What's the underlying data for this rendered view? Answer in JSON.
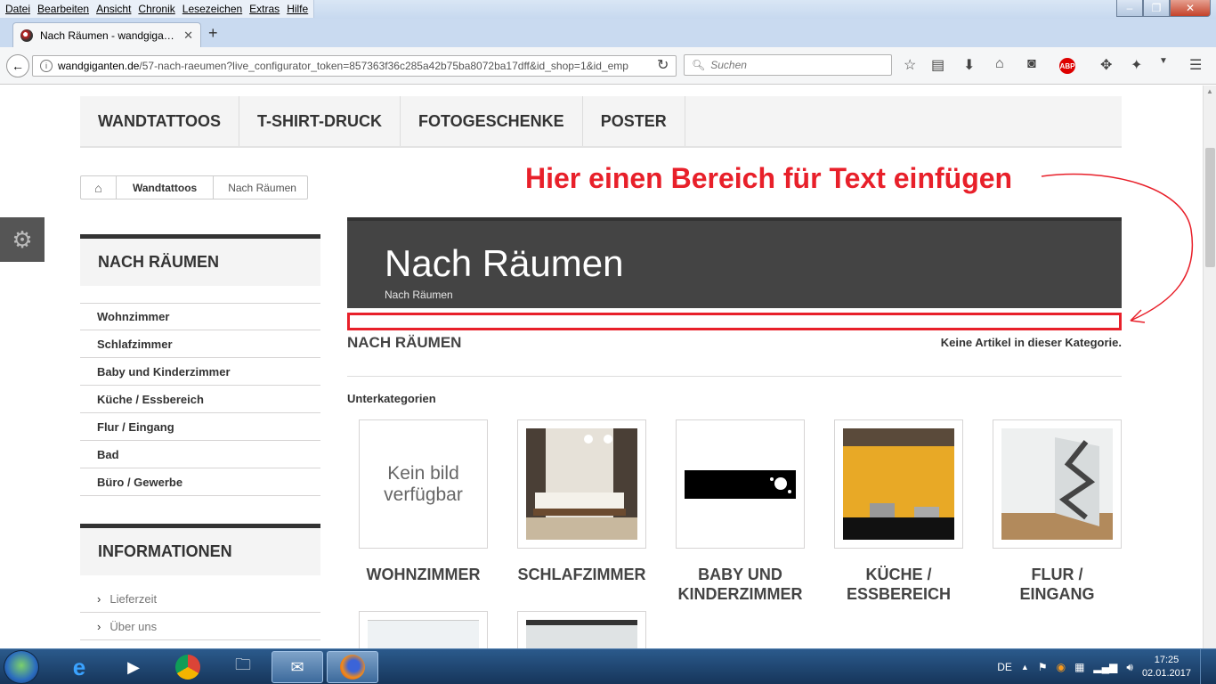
{
  "browser": {
    "menu": [
      "Datei",
      "Bearbeiten",
      "Ansicht",
      "Chronik",
      "Lesezeichen",
      "Extras",
      "Hilfe"
    ],
    "tab_title": "Nach Räumen - wandgiga…",
    "url_domain": "wandgiganten.de",
    "url_path": "/57-nach-raeumen?live_configurator_token=857363f36c285a42b75ba8072ba17dff&id_shop=1&id_emp",
    "search_placeholder": "Suchen",
    "abp_label": "ABP"
  },
  "site": {
    "nav": [
      "WANDTATTOOS",
      "T-SHIRT-DRUCK",
      "FOTOGESCHENKE",
      "POSTER"
    ],
    "breadcrumb": [
      "Wandtattoos",
      "Nach Räumen"
    ],
    "sidebar_title": "NACH RÄUMEN",
    "categories": [
      "Wohnzimmer",
      "Schlafzimmer",
      "Baby und Kinderzimmer",
      "Küche / Essbereich",
      "Flur / Eingang",
      "Bad",
      "Büro / Gewerbe"
    ],
    "info_title": "INFORMATIONEN",
    "info_links": [
      "Lieferzeit",
      "Über uns"
    ],
    "header_title": "Nach Räumen",
    "header_subtitle": "Nach Räumen",
    "section_heading": "NACH RÄUMEN",
    "empty_message": "Keine Artikel in dieser Kategorie.",
    "subcat_heading": "Unterkategorien",
    "no_image_text": "Kein bild verfügbar",
    "subcategories": [
      "WOHNZIMMER",
      "SCHLAFZIMMER",
      "BABY UND KINDERZIMMER",
      "KÜCHE / ESSBEREICH",
      "FLUR / EINGANG"
    ]
  },
  "annotation": {
    "text": "Hier einen Bereich für Text einfügen",
    "color": "#e8202a"
  },
  "taskbar": {
    "language": "DE",
    "time": "17:25",
    "date": "02.01.2017"
  }
}
